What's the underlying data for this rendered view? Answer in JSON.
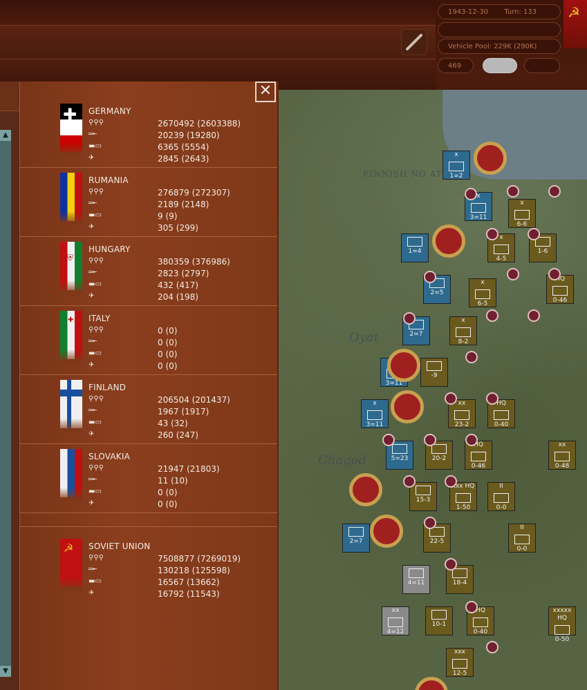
{
  "header": {
    "date": "1943-12-30",
    "turn": "Turn: 133",
    "vehicle_pool": "Vehicle Pool: 229K (290K)",
    "counter_value": "469"
  },
  "countries": [
    {
      "name": "GERMANY",
      "men": "2670492 (2603388)",
      "guns": "20239 (19280)",
      "afv": "6365 (5554)",
      "aircraft": "2845 (2643)"
    },
    {
      "name": "RUMANIA",
      "men": "276879 (272307)",
      "guns": "2189 (2148)",
      "afv": "9 (9)",
      "aircraft": "305 (299)"
    },
    {
      "name": "HUNGARY",
      "men": "380359 (376986)",
      "guns": "2823 (2797)",
      "afv": "432 (417)",
      "aircraft": "204 (198)"
    },
    {
      "name": "ITALY",
      "men": "0 (0)",
      "guns": "0 (0)",
      "afv": "0 (0)",
      "aircraft": "0 (0)"
    },
    {
      "name": "FINLAND",
      "men": "206504 (201437)",
      "guns": "1967 (1917)",
      "afv": "43 (32)",
      "aircraft": "260 (247)"
    },
    {
      "name": "SLOVAKIA",
      "men": "21947 (21803)",
      "guns": "11 (10)",
      "afv": "0 (0)",
      "aircraft": "0 (0)"
    },
    {
      "name": "SOVIET UNION",
      "men": "7508877 (7269019)",
      "guns": "130218 (125598)",
      "afv": "16567 (13662)",
      "aircraft": "16792 (11543)"
    }
  ],
  "map": {
    "labels": [
      "FINNISH NO AT",
      "Oyat",
      "Chagod"
    ],
    "counters": [
      {
        "class": "c-blue",
        "size": "x",
        "str": "1=2"
      },
      {
        "class": "c-blue",
        "size": "x",
        "str": "3=11"
      },
      {
        "class": "c-olive",
        "size": "x",
        "str": "6-6"
      },
      {
        "class": "c-blue",
        "size": "",
        "str": "1=4"
      },
      {
        "class": "c-olive",
        "size": "x",
        "str": "4-5"
      },
      {
        "class": "c-olive",
        "size": "",
        "str": "1-6"
      },
      {
        "class": "c-blue",
        "size": "",
        "str": "2=5"
      },
      {
        "class": "c-olive",
        "size": "x",
        "str": "6-5"
      },
      {
        "class": "c-olive",
        "size": "HQ",
        "str": "0-46"
      },
      {
        "class": "c-blue",
        "size": "",
        "str": "2=7"
      },
      {
        "class": "c-olive",
        "size": "x",
        "str": "8-2"
      },
      {
        "class": "c-blue",
        "size": "xx",
        "str": "3=11"
      },
      {
        "class": "c-olive",
        "size": "",
        "str": "-9"
      },
      {
        "class": "c-blue",
        "size": "x",
        "str": "3=11"
      },
      {
        "class": "c-olive",
        "size": "xx",
        "str": "23-2"
      },
      {
        "class": "c-olive",
        "size": "HQ",
        "str": "0-40"
      },
      {
        "class": "c-blue",
        "size": "",
        "str": "5=23"
      },
      {
        "class": "c-olive",
        "size": "",
        "str": "20-2"
      },
      {
        "class": "c-olive",
        "size": "HQ",
        "str": "0-46"
      },
      {
        "class": "c-olive",
        "size": "xx",
        "str": "0-48"
      },
      {
        "class": "c-olive",
        "size": "",
        "str": "15-3"
      },
      {
        "class": "c-olive",
        "size": "xxx HQ",
        "str": "1-50"
      },
      {
        "class": "c-olive",
        "size": "II",
        "str": "0-0"
      },
      {
        "class": "c-blue",
        "size": "",
        "str": "2=7"
      },
      {
        "class": "c-olive",
        "size": "",
        "str": "22-5"
      },
      {
        "class": "c-olive",
        "size": "II",
        "str": "0-0"
      },
      {
        "class": "c-grey",
        "size": "",
        "str": "4=11"
      },
      {
        "class": "c-olive",
        "size": "",
        "str": "18-4"
      },
      {
        "class": "c-grey",
        "size": "xx",
        "str": "4=12"
      },
      {
        "class": "c-olive",
        "size": "",
        "str": "10-1"
      },
      {
        "class": "c-olive",
        "size": "HQ",
        "str": "0-40"
      },
      {
        "class": "c-olive",
        "size": "xxxxx HQ",
        "str": "0-50"
      },
      {
        "class": "c-olive",
        "size": "xxx",
        "str": "12-5"
      }
    ]
  }
}
